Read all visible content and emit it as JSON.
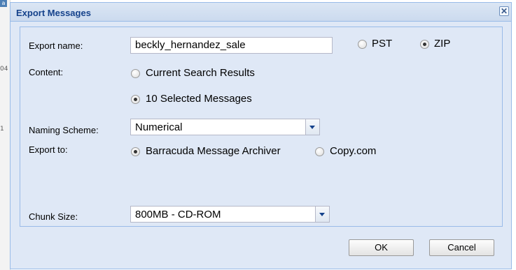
{
  "dialog": {
    "title": "Export Messages",
    "close_symbol": "✕"
  },
  "form": {
    "export_name": {
      "label": "Export name:",
      "value": "beckly_hernandez_sale"
    },
    "format": {
      "options": [
        {
          "label": "PST",
          "selected": false
        },
        {
          "label": "ZIP",
          "selected": true
        }
      ]
    },
    "content": {
      "label": "Content:",
      "options": [
        {
          "label": "Current Search Results",
          "selected": false
        },
        {
          "label": "10 Selected Messages",
          "selected": true
        }
      ]
    },
    "naming_scheme": {
      "label": "Naming Scheme:",
      "value": "Numerical"
    },
    "export_to": {
      "label": "Export to:",
      "options": [
        {
          "label": "Barracuda Message Archiver",
          "selected": true
        },
        {
          "label": "Copy.com",
          "selected": false
        }
      ]
    },
    "chunk_size": {
      "label": "Chunk Size:",
      "value": "800MB - CD-ROM"
    }
  },
  "buttons": {
    "ok": "OK",
    "cancel": "Cancel"
  },
  "background": {
    "ticks": [
      "04",
      "1"
    ]
  },
  "colors": {
    "title_text": "#15428b",
    "dialog_bg": "#dfe8f6",
    "border": "#99bbe8"
  }
}
